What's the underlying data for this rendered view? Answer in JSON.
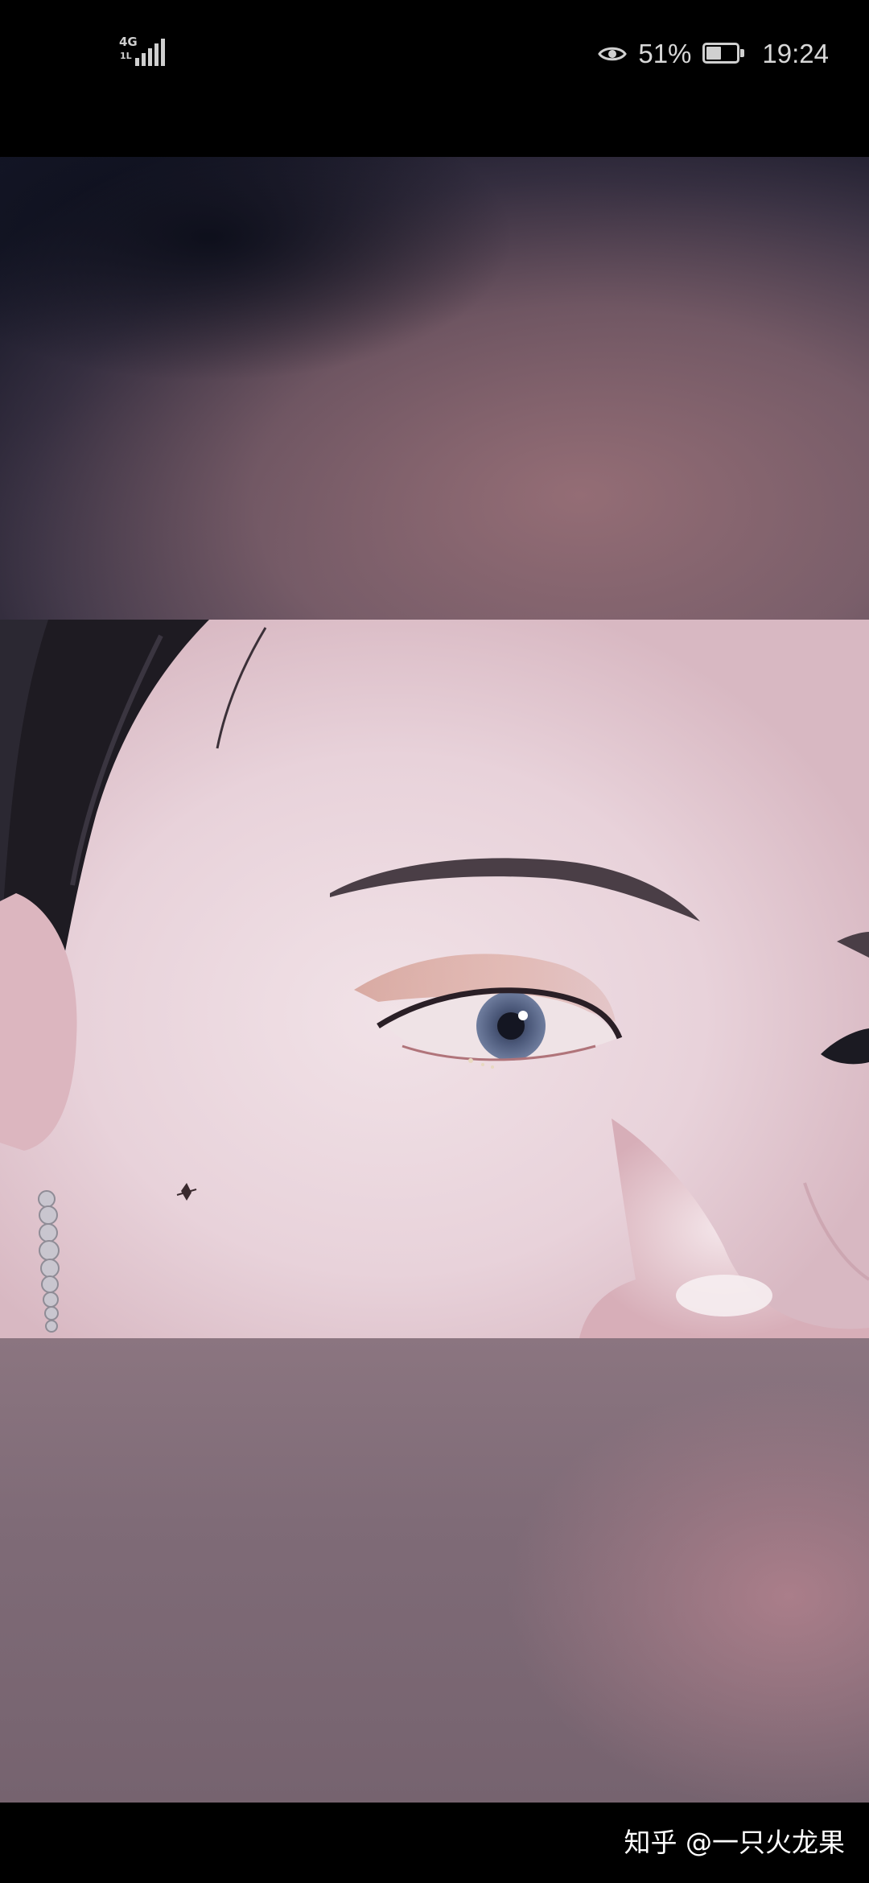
{
  "status_bar": {
    "network_type": "4G",
    "network_sub": "1L",
    "signal_level": 4,
    "battery_text": "51%",
    "battery_level_percent": 51,
    "time": "19:24",
    "icons": [
      "signal-icon",
      "eye-comfort-icon",
      "battery-icon"
    ]
  },
  "photo": {
    "subject": "close-up face photo"
  },
  "watermark": {
    "text": "知乎 @一只火龙果"
  }
}
